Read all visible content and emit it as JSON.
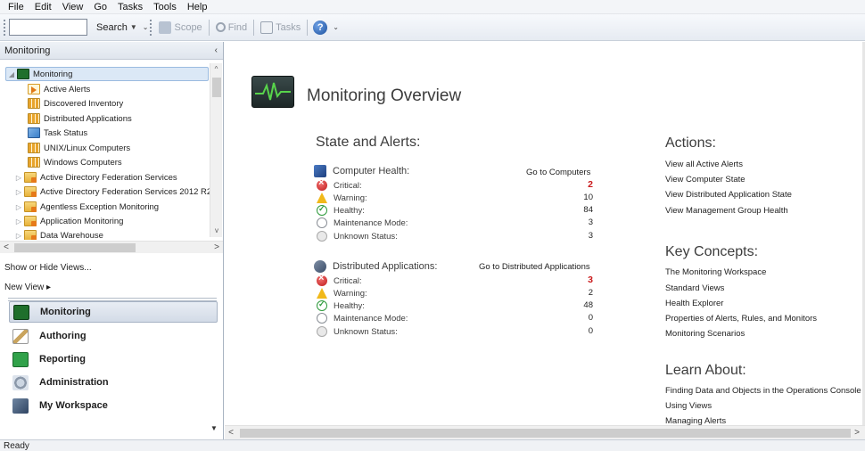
{
  "menu": [
    "File",
    "Edit",
    "View",
    "Go",
    "Tasks",
    "Tools",
    "Help"
  ],
  "toolbar": {
    "search_value": "",
    "search_label": "Search",
    "scope_label": "Scope",
    "find_label": "Find",
    "tasks_label": "Tasks"
  },
  "left": {
    "header": "Monitoring",
    "tree": [
      {
        "label": "Monitoring",
        "icon": "monitor-icon",
        "level": 0,
        "expanded": true,
        "selected": true
      },
      {
        "label": "Active Alerts",
        "icon": "alert-view-icon",
        "level": 1
      },
      {
        "label": "Discovered Inventory",
        "icon": "state-view-icon",
        "level": 1
      },
      {
        "label": "Distributed Applications",
        "icon": "state-view-icon",
        "level": 1
      },
      {
        "label": "Task Status",
        "icon": "task-status-icon",
        "level": 1
      },
      {
        "label": "UNIX/Linux Computers",
        "icon": "state-view-icon",
        "level": 1
      },
      {
        "label": "Windows Computers",
        "icon": "state-view-icon",
        "level": 1
      },
      {
        "label": "Active Directory Federation Services",
        "icon": "folder-icon",
        "level": 1,
        "collapsed": true
      },
      {
        "label": "Active Directory Federation Services 2012 R2",
        "icon": "folder-icon",
        "level": 1,
        "collapsed": true
      },
      {
        "label": "Agentless Exception Monitoring",
        "icon": "folder-icon",
        "level": 1,
        "collapsed": true
      },
      {
        "label": "Application Monitoring",
        "icon": "folder-icon",
        "level": 1,
        "collapsed": true
      },
      {
        "label": "Data Warehouse",
        "icon": "folder-icon",
        "level": 1,
        "collapsed": true
      }
    ],
    "show_hide_views": "Show or Hide Views...",
    "new_view": "New View ▸",
    "workspaces": [
      {
        "label": "Monitoring",
        "icon": "monitoring-workspace-icon",
        "active": true
      },
      {
        "label": "Authoring",
        "icon": "authoring-workspace-icon"
      },
      {
        "label": "Reporting",
        "icon": "reporting-workspace-icon"
      },
      {
        "label": "Administration",
        "icon": "administration-workspace-icon"
      },
      {
        "label": "My Workspace",
        "icon": "my-workspace-icon"
      }
    ]
  },
  "main": {
    "title": "Monitoring Overview",
    "state_alerts_title": "State and Alerts:",
    "computer_health": {
      "label": "Computer Health:",
      "link": "Go to Computers",
      "rows": [
        {
          "label": "Critical:",
          "value": "2",
          "status": "critical"
        },
        {
          "label": "Warning:",
          "value": "10",
          "status": "warning"
        },
        {
          "label": "Healthy:",
          "value": "84",
          "status": "healthy"
        },
        {
          "label": "Maintenance Mode:",
          "value": "3",
          "status": "maintenance"
        },
        {
          "label": "Unknown Status:",
          "value": "3",
          "status": "unknown"
        }
      ]
    },
    "distributed_apps": {
      "label": "Distributed Applications:",
      "link": "Go to Distributed Applications",
      "rows": [
        {
          "label": "Critical:",
          "value": "3",
          "status": "critical"
        },
        {
          "label": "Warning:",
          "value": "2",
          "status": "warning"
        },
        {
          "label": "Healthy:",
          "value": "48",
          "status": "healthy"
        },
        {
          "label": "Maintenance Mode:",
          "value": "0",
          "status": "maintenance"
        },
        {
          "label": "Unknown Status:",
          "value": "0",
          "status": "unknown"
        }
      ]
    },
    "actions": {
      "title": "Actions:",
      "items": [
        "View all Active Alerts",
        "View Computer State",
        "View Distributed Application State",
        "View Management Group Health"
      ]
    },
    "key_concepts": {
      "title": "Key Concepts:",
      "items": [
        "The Monitoring Workspace",
        "Standard Views",
        "Health Explorer",
        "Properties of Alerts, Rules, and Monitors",
        "Monitoring Scenarios"
      ]
    },
    "learn_about": {
      "title": "Learn About:",
      "items": [
        "Finding Data and Objects in the Operations Console",
        "Using Views",
        "Managing Alerts"
      ]
    }
  },
  "status_bar": "Ready",
  "colors": {
    "critical": "#c9181a",
    "accent": "#1f6f2c"
  }
}
